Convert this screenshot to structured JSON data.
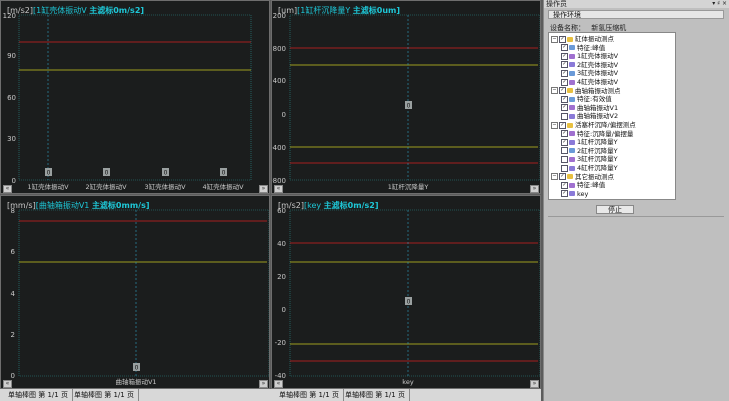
{
  "charts": [
    {
      "unit": "[m/s2]",
      "legend_name": "[1缸壳体振动V",
      "legend_value": "主滤标0m/s2]",
      "yticks": [
        "120",
        "90",
        "60",
        "30",
        "0"
      ],
      "xlabels": [
        "1缸壳体振动V",
        "2缸壳体振动V",
        "3缸壳体振动V",
        "4缸壳体振动V"
      ],
      "bar_values": [
        "0",
        "0",
        "0",
        "0"
      ]
    },
    {
      "unit": "[um]",
      "legend_name": "[1缸杆沉降量Y",
      "legend_value": "主滤标0um]",
      "yticks": [
        "1200",
        "800",
        "400",
        "0",
        "-400",
        "-800"
      ],
      "xlabels": [
        "1缸杆沉降量Y"
      ],
      "bar_values": [
        "0"
      ]
    },
    {
      "unit": "[mm/s]",
      "legend_name": "[曲轴箱振动V1",
      "legend_value": "主滤标0mm/s]",
      "yticks": [
        "8",
        "6",
        "4",
        "2",
        "0"
      ],
      "xlabels": [
        "曲轴箱振动V1"
      ],
      "bar_values": [
        "0"
      ]
    },
    {
      "unit": "[m/s2]",
      "legend_name": "[key",
      "legend_value": "主滤标0m/s2]",
      "yticks": [
        "60",
        "40",
        "20",
        "0",
        "-20",
        "-40"
      ],
      "xlabels": [
        "key"
      ],
      "bar_values": [
        "0"
      ]
    }
  ],
  "tabs": [
    "单轴棒图 第 1/1 页",
    "单轴棒图 第 1/1 页",
    "单轴棒图 第 1/1 页",
    "单轴棒图 第 1/1 页"
  ],
  "ops": {
    "title": "操作员",
    "window_controls": "▾ ♯ ×",
    "env_button": "操作环境",
    "device_label": "设备名称：",
    "device_value": "新氢压缩机",
    "tree": [
      {
        "level": 0,
        "label": "缸体振动测点",
        "expand": "−",
        "checked": "✓"
      },
      {
        "level": 1,
        "label": "特征:峰值",
        "checked": "✓"
      },
      {
        "level": 1,
        "label": "1缸壳体振动V",
        "checked": "✓"
      },
      {
        "level": 1,
        "label": "2缸壳体振动V",
        "checked": "✓"
      },
      {
        "level": 1,
        "label": "3缸壳体振动V",
        "checked": "✓"
      },
      {
        "level": 1,
        "label": "4缸壳体振动V",
        "checked": "✓"
      },
      {
        "level": 0,
        "label": "曲轴箱振动测点",
        "expand": "−",
        "checked": "✓"
      },
      {
        "level": 1,
        "label": "特征:有效值",
        "checked": "✓"
      },
      {
        "level": 1,
        "label": "曲轴箱振动V1",
        "checked": "✓"
      },
      {
        "level": 1,
        "label": "曲轴箱振动V2",
        "checked": ""
      },
      {
        "level": 0,
        "label": "活塞杆沉降/偏摆测点",
        "expand": "−",
        "checked": "✓"
      },
      {
        "level": 1,
        "label": "特征:沉降量/偏摆量",
        "checked": "✓"
      },
      {
        "level": 1,
        "label": "1缸杆沉降量Y",
        "checked": "✓"
      },
      {
        "level": 1,
        "label": "2缸杆沉降量Y",
        "checked": ""
      },
      {
        "level": 1,
        "label": "3缸杆沉降量Y",
        "checked": ""
      },
      {
        "level": 1,
        "label": "4缸杆沉降量Y",
        "checked": ""
      },
      {
        "level": 0,
        "label": "其它振动测点",
        "expand": "−",
        "checked": "✓"
      },
      {
        "level": 1,
        "label": "特征:峰值",
        "checked": "✓"
      },
      {
        "level": 1,
        "label": "key",
        "checked": "✓"
      }
    ],
    "stop_button": "停止"
  },
  "colors": {
    "alarm_high": "#d42020",
    "alarm_warn": "#c8c820",
    "grid": "#2a8a8a",
    "cursor": "#30a0c0",
    "highlight": "#1ec8d8"
  }
}
